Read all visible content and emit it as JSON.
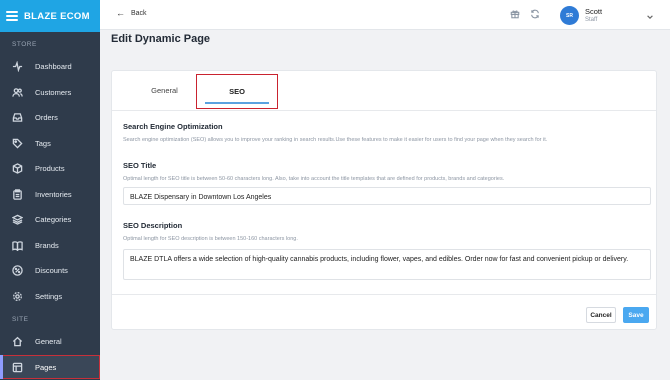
{
  "brand": {
    "name": "BLAZE ECOM"
  },
  "sidebar": {
    "store_label": "STORE",
    "site_label": "SITE",
    "items": [
      {
        "label": "Dashboard",
        "icon": "activity-icon"
      },
      {
        "label": "Customers",
        "icon": "users-icon"
      },
      {
        "label": "Orders",
        "icon": "tray-icon"
      },
      {
        "label": "Tags",
        "icon": "tag-icon"
      },
      {
        "label": "Products",
        "icon": "box-icon"
      },
      {
        "label": "Inventories",
        "icon": "clipboard-icon"
      },
      {
        "label": "Categories",
        "icon": "layers-icon"
      },
      {
        "label": "Brands",
        "icon": "book-icon"
      },
      {
        "label": "Discounts",
        "icon": "percent-icon"
      },
      {
        "label": "Settings",
        "icon": "gear-icon"
      }
    ],
    "site_items": [
      {
        "label": "General",
        "icon": "home-icon"
      },
      {
        "label": "Pages",
        "icon": "layout-icon",
        "active": true
      }
    ]
  },
  "topbar": {
    "back_label": "Back",
    "user": {
      "initials": "SR",
      "name": "Scott",
      "role": "Staff"
    }
  },
  "page": {
    "title": "Edit Dynamic Page"
  },
  "tabs": [
    {
      "label": "General",
      "active": false
    },
    {
      "label": "SEO",
      "active": true
    }
  ],
  "seo": {
    "heading": "Search Engine Optimization",
    "help": "Search engine optimization (SEO) allows you to improve your ranking in search results.Use these features to make it easier for users to find your page when they search for it.",
    "title_label": "SEO Title",
    "title_help": "Optimal length for SEO title is between 50-60 characters long. Also, take into account the title templates that are defined for products, brands and categories.",
    "title_value": "BLAZE Dispensary in Downtown Los Angeles",
    "desc_label": "SEO Description",
    "desc_help": "Optimal length for SEO description is between 150-160 characters long.",
    "desc_value": "BLAZE DTLA offers a wide selection of high-quality cannabis products, including flower, vapes, and edibles. Order now for fast and convenient pickup or delivery."
  },
  "actions": {
    "cancel_label": "Cancel",
    "save_label": "Save"
  },
  "colors": {
    "sidebar": "#2f3b4b",
    "brand": "#1fa5e4",
    "accent": "#4aa8f0",
    "highlight": "#c9232f"
  }
}
